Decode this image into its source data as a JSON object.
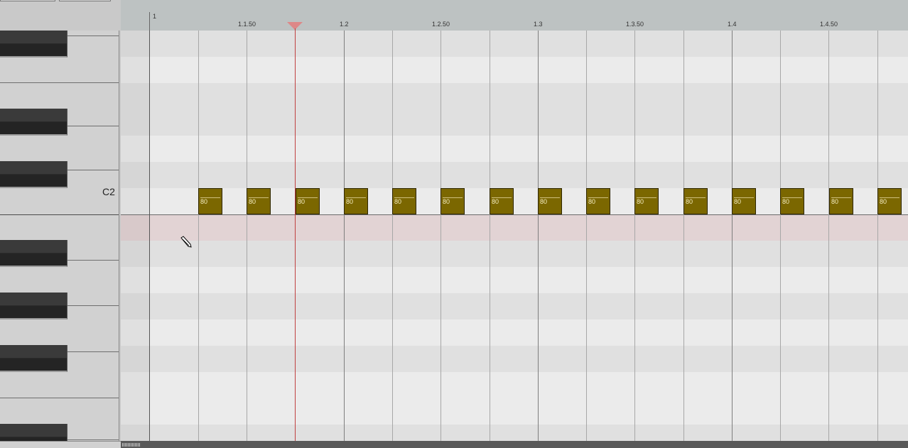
{
  "ruler": {
    "labels": [
      "1",
      "1.1.50",
      "1.2",
      "1.2.50",
      "1.3",
      "1.3.50",
      "1.4",
      "1.4.50"
    ]
  },
  "keyboard": {
    "octave_label": "C2"
  },
  "notes": [
    {
      "velocity": "80"
    },
    {
      "velocity": "80"
    },
    {
      "velocity": "80"
    },
    {
      "velocity": "80"
    },
    {
      "velocity": "80"
    },
    {
      "velocity": "80"
    },
    {
      "velocity": "80"
    },
    {
      "velocity": "80"
    },
    {
      "velocity": "80"
    },
    {
      "velocity": "80"
    },
    {
      "velocity": "80"
    },
    {
      "velocity": "80"
    },
    {
      "velocity": "80"
    },
    {
      "velocity": "80"
    },
    {
      "velocity": "80"
    }
  ],
  "colors": {
    "note_fill": "#7b6700",
    "playhead": "#c04040",
    "highlight_row": "#e2d3d4"
  },
  "tool": "pencil-icon"
}
